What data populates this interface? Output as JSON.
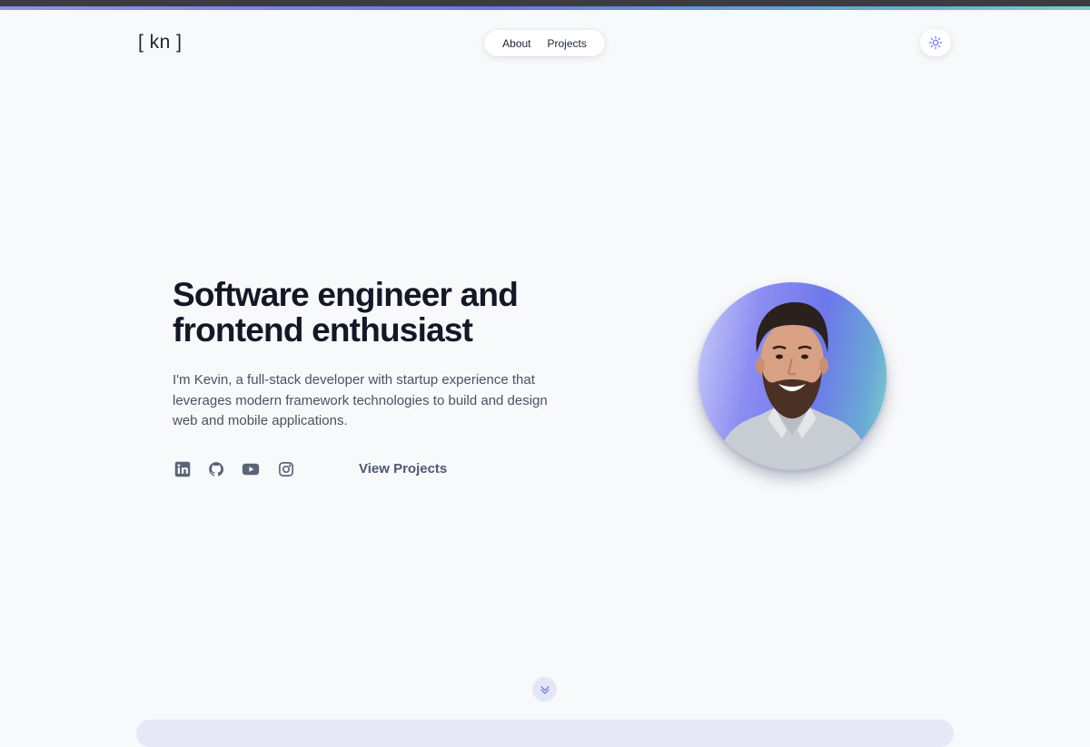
{
  "brand": {
    "logo": "[ kn ]"
  },
  "nav": {
    "items": [
      {
        "label": "About"
      },
      {
        "label": "Projects"
      }
    ]
  },
  "theme_toggle": {
    "icon": "sun-icon"
  },
  "hero": {
    "title_line1": "Software engineer and",
    "title_line2": "frontend enthusiast",
    "description": "I'm Kevin, a full-stack developer with startup experience that leverages modern framework technologies to build and design web and mobile applications.",
    "cta": "View Projects",
    "socials": [
      {
        "icon": "linkedin-icon"
      },
      {
        "icon": "github-icon"
      },
      {
        "icon": "youtube-icon"
      },
      {
        "icon": "instagram-icon"
      }
    ]
  },
  "avatar": {
    "gradient": [
      "#c9cdf7",
      "#6d78ea",
      "#7ed6c9"
    ]
  },
  "scroll_indicator": {
    "icon": "chevrons-down-icon"
  },
  "colors": {
    "background": "#f8f9fb",
    "accent": "#6d74ea",
    "text_dark": "#141826",
    "text_muted": "#4d5a70"
  }
}
